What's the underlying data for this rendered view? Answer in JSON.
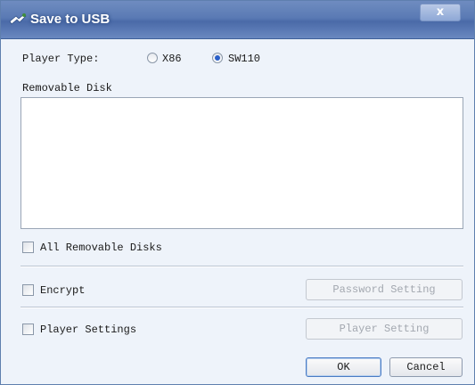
{
  "window": {
    "title": "Save to USB",
    "close_symbol": "x"
  },
  "player_type": {
    "label": "Player Type:",
    "options": [
      {
        "label": "X86",
        "selected": false
      },
      {
        "label": "SW110",
        "selected": true
      }
    ]
  },
  "removable_disk": {
    "label": "Removable Disk",
    "items": []
  },
  "all_removable_disks": {
    "label": "All Removable Disks",
    "checked": false
  },
  "encrypt": {
    "label": "Encrypt",
    "checked": false,
    "button_label": "Password Setting",
    "button_enabled": false
  },
  "player_settings": {
    "label": "Player Settings",
    "checked": false,
    "button_label": "Player Setting",
    "button_enabled": false
  },
  "footer": {
    "ok_label": "OK",
    "cancel_label": "Cancel"
  },
  "icons": {
    "title_icon": "usb-save-icon",
    "close_icon": "close-icon"
  }
}
